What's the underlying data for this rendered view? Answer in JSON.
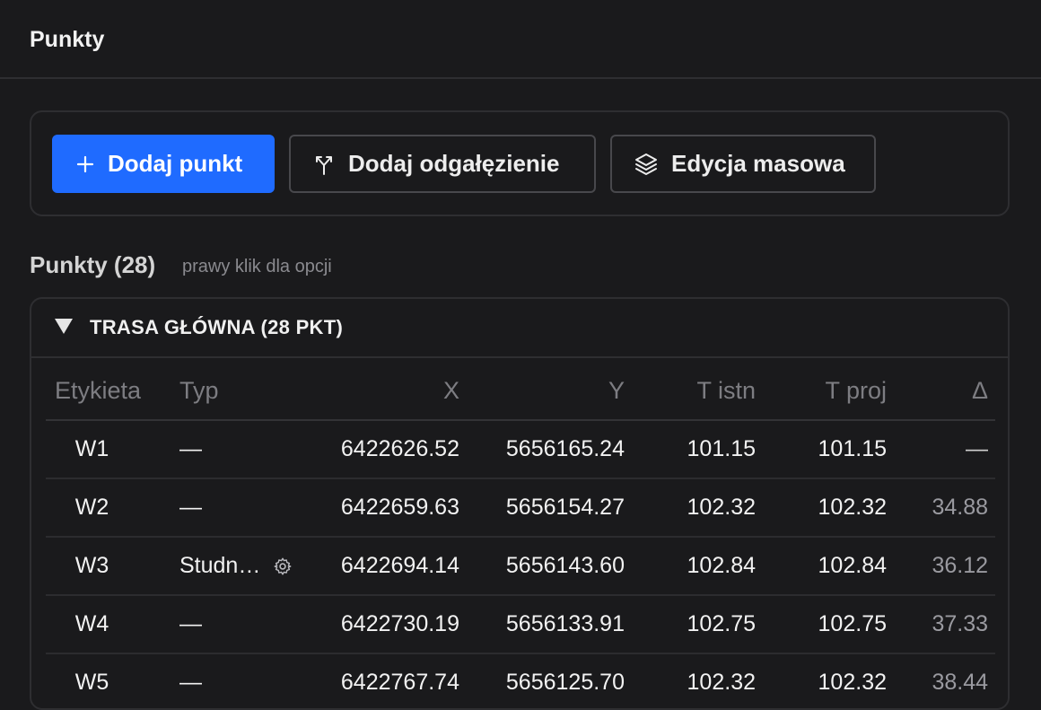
{
  "header": {
    "title": "Punkty"
  },
  "toolbar": {
    "add_point": "Dodaj punkt",
    "add_branch": "Dodaj odgałęzienie",
    "mass_edit": "Edycja masowa"
  },
  "section": {
    "title": "Punkty (28)",
    "hint": "prawy klik dla opcji"
  },
  "group": {
    "label": "TRASA GŁÓWNA (28 PKT)"
  },
  "table": {
    "columns": [
      "Etykieta",
      "Typ",
      "X",
      "Y",
      "T istn",
      "T proj",
      "Δ"
    ],
    "rows": [
      {
        "label": "W1",
        "type": "—",
        "x": "6422626.52",
        "y": "5656165.24",
        "t_istn": "101.15",
        "t_proj": "101.15",
        "delta": "—"
      },
      {
        "label": "W2",
        "type": "—",
        "x": "6422659.63",
        "y": "5656154.27",
        "t_istn": "102.32",
        "t_proj": "102.32",
        "delta": "34.88"
      },
      {
        "label": "W3",
        "type": "Studn…",
        "x": "6422694.14",
        "y": "5656143.60",
        "t_istn": "102.84",
        "t_proj": "102.84",
        "delta": "36.12"
      },
      {
        "label": "W4",
        "type": "—",
        "x": "6422730.19",
        "y": "5656133.91",
        "t_istn": "102.75",
        "t_proj": "102.75",
        "delta": "37.33"
      },
      {
        "label": "W5",
        "type": "—",
        "x": "6422767.74",
        "y": "5656125.70",
        "t_istn": "102.32",
        "t_proj": "102.32",
        "delta": "38.44"
      }
    ]
  },
  "colors": {
    "background": "#1a1a1c",
    "primary": "#1f6bff",
    "border": "#2e2e31",
    "muted_text": "#7d7d82"
  },
  "icons": {
    "add_point": "plus-icon",
    "add_branch": "branch-icon",
    "mass_edit": "layers-icon",
    "group_toggle": "triangle-down-icon",
    "type_settings": "gear-icon"
  }
}
